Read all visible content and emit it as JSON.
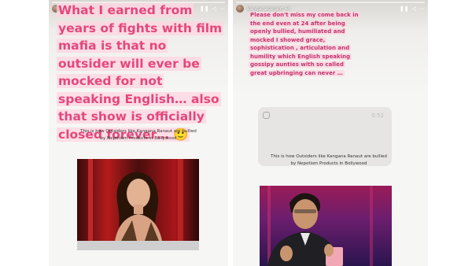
{
  "left_story": {
    "username": "kanganaranaut",
    "time": "6d",
    "main_text": "What I earned from years of fights with film mafia is that no outsider will ever be mocked for not speaking English… also that show is officially closed forever… 🙂",
    "caption": "This is how Outsiders like Kangana Ranaut are bullied by Nepotism Products in Bollywood"
  },
  "right_story": {
    "username": "kanganaranaut",
    "time": "6d",
    "main_text": "Please don't miss my come back in the end even at 24 after being openly bullied, humiliated and mocked I showed grace, sophistication , articulation and humility which English speaking gossipy aunties with so called great upbringing can never …",
    "card_time": "0:52",
    "caption": "This is how Outsiders like Kangana Ranaut are bullied by Nepotism Products in Bollywood"
  },
  "icons": {
    "pause": "❚❚",
    "mute": "◁",
    "more": "⋯"
  }
}
